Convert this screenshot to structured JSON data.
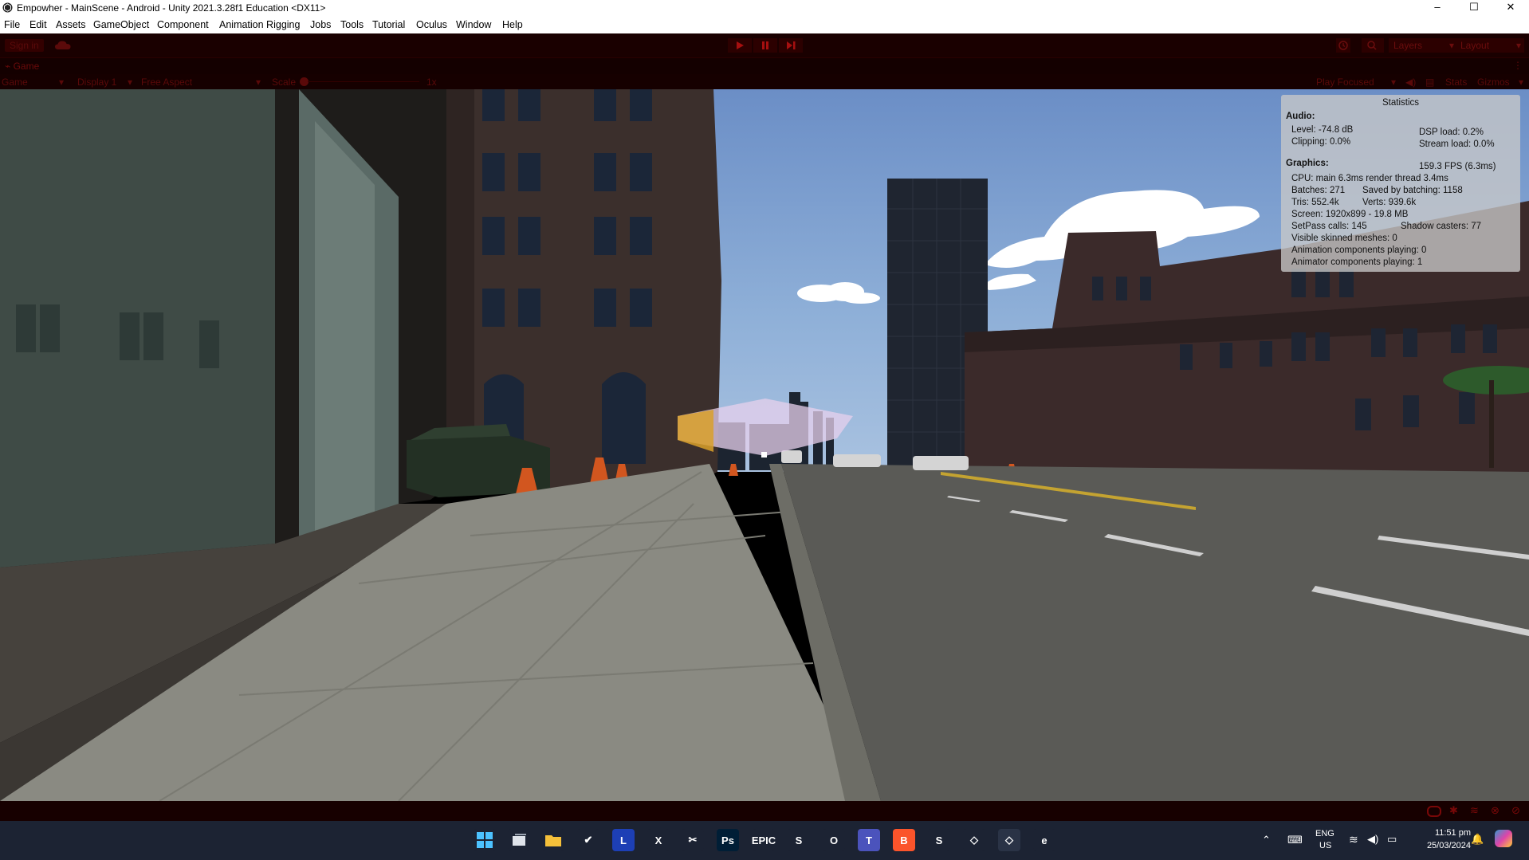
{
  "window": {
    "title": "Empowher - MainScene - Android - Unity 2021.3.28f1 Education <DX11>",
    "controls": [
      "–",
      "☐",
      "✕"
    ]
  },
  "menu": [
    "File",
    "Edit",
    "Assets",
    "GameObject",
    "Component",
    "Animation Rigging",
    "Jobs",
    "Tools",
    "Tutorial",
    "Oculus",
    "Window",
    "Help"
  ],
  "toolbar": {
    "sign_in": "Sign in",
    "layers": "Layers",
    "layout": "Layout"
  },
  "game_tab": {
    "label": "Game"
  },
  "game_bar": {
    "mode": "Game",
    "display": "Display 1",
    "aspect": "Free Aspect",
    "scale_label": "Scale",
    "scale_value": "1x",
    "play_mode": "Play Focused",
    "stats": "Stats",
    "gizmos": "Gizmos"
  },
  "stats": {
    "title": "Statistics",
    "audio_header": "Audio:",
    "level": "Level: -74.8 dB",
    "dsp": "DSP load: 0.2%",
    "clipping": "Clipping: 0.0%",
    "stream": "Stream load: 0.0%",
    "graphics_header": "Graphics:",
    "fps": "159.3 FPS (6.3ms)",
    "cpu": "CPU: main 6.3ms  render thread 3.4ms",
    "batches": "Batches: 271",
    "saved": "Saved by batching: 1158",
    "tris": "Tris: 552.4k",
    "verts": "Verts: 939.6k",
    "screen": "Screen: 1920x899 - 19.8 MB",
    "setpass": "SetPass calls: 145",
    "shadow": "Shadow casters: 77",
    "skinned": "Visible skinned meshes: 0",
    "anim": "Animation components playing: 0",
    "animator": "Animator components playing: 1"
  },
  "taskbar": {
    "apps": [
      {
        "name": "windows-start-icon",
        "glyph": "",
        "bg": "#1c2333"
      },
      {
        "name": "task-view-icon",
        "glyph": "",
        "bg": "#1c2333"
      },
      {
        "name": "file-explorer-icon",
        "glyph": "",
        "bg": "#1c2333"
      },
      {
        "name": "todo-icon",
        "glyph": "✔",
        "bg": "#1c2333"
      },
      {
        "name": "l-app-icon",
        "glyph": "L",
        "bg": "#1d3fb5"
      },
      {
        "name": "xbox-icon",
        "glyph": "X",
        "bg": "#1c2333"
      },
      {
        "name": "capcut-icon",
        "glyph": "✂",
        "bg": "#1c2333"
      },
      {
        "name": "photoshop-icon",
        "glyph": "Ps",
        "bg": "#001e36"
      },
      {
        "name": "epic-games-icon",
        "glyph": "EPIC",
        "bg": "#1c2333"
      },
      {
        "name": "steam-icon",
        "glyph": "S",
        "bg": "#1c2333"
      },
      {
        "name": "opera-icon",
        "glyph": "O",
        "bg": "#1c2333"
      },
      {
        "name": "teams-icon",
        "glyph": "T",
        "bg": "#4b53bc"
      },
      {
        "name": "brave-icon",
        "glyph": "B",
        "bg": "#fb542b"
      },
      {
        "name": "steam-2-icon",
        "glyph": "S",
        "bg": "#1c2333"
      },
      {
        "name": "unity-hub-icon",
        "glyph": "◇",
        "bg": "#1c2333"
      },
      {
        "name": "unity-editor-icon",
        "glyph": "◇",
        "bg": "#2a3346"
      },
      {
        "name": "edge-icon",
        "glyph": "e",
        "bg": "#1c2333"
      }
    ],
    "lang": "ENG",
    "region": "US",
    "time": "11:51 pm",
    "date": "25/03/2024"
  }
}
